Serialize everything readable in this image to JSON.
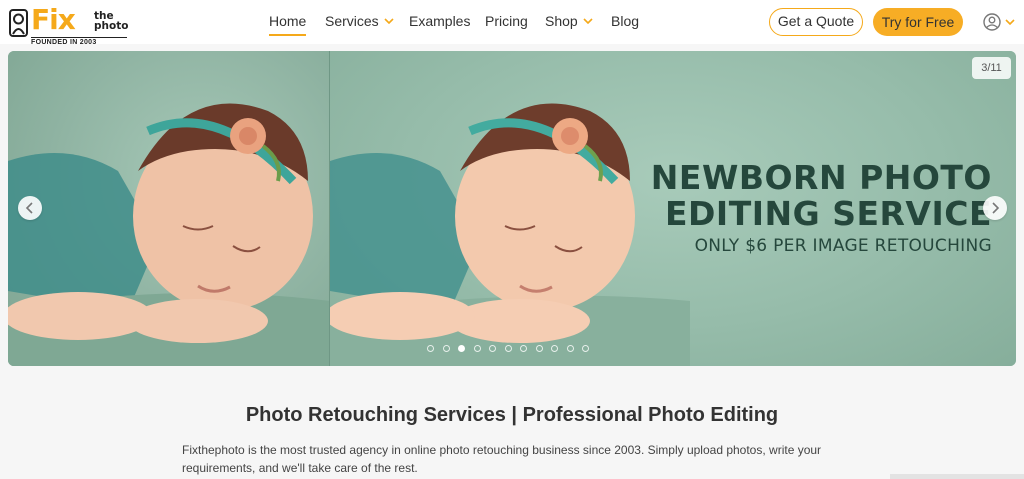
{
  "brand": {
    "fix": "Fix",
    "the": "the",
    "photo": "photo",
    "founded": "FOUNDED IN 2003",
    "accent_color": "#f5a91a"
  },
  "nav": {
    "items": [
      {
        "label": "Home",
        "active": true
      },
      {
        "label": "Services",
        "dropdown": true
      },
      {
        "label": "Examples"
      },
      {
        "label": "Pricing"
      },
      {
        "label": "Shop",
        "dropdown": true
      },
      {
        "label": "Blog"
      }
    ]
  },
  "header_actions": {
    "quote_label": "Get a Quote",
    "try_label": "Try for Free",
    "user_icon": "user-circle-icon"
  },
  "hero": {
    "counter": "3/11",
    "title": "NEWBORN PHOTO EDITING SERVICE",
    "subtitle": "ONLY $6 PER IMAGE RETOUCHING",
    "slide_count": 11,
    "active_slide": 3,
    "prev_icon": "chevron-left-icon",
    "next_icon": "chevron-right-icon"
  },
  "intro": {
    "title": "Photo Retouching Services | Professional Photo Editing",
    "text": "Fixthephoto is the most trusted agency in online photo retouching business since 2003. Simply upload photos, write your requirements, and we'll take care of the rest."
  }
}
